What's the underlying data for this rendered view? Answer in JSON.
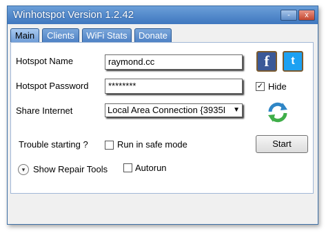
{
  "window": {
    "title": "Winhotspot Version 1.2.42",
    "minimize_label": "-",
    "close_label": "x"
  },
  "tabs": [
    {
      "label": "Main"
    },
    {
      "label": "Clients"
    },
    {
      "label": "WiFi Stats"
    },
    {
      "label": "Donate"
    }
  ],
  "main": {
    "hotspot_name_label": "Hotspot Name",
    "hotspot_name_value": "raymond.cc",
    "hotspot_password_label": "Hotspot Password",
    "hotspot_password_value": "********",
    "hide_label": "Hide",
    "hide_checked": "✓",
    "share_internet_label": "Share Internet",
    "share_internet_value": "Local Area Connection {3935I",
    "trouble_label": "Trouble starting ?",
    "safe_mode_label": "Run in safe mode",
    "start_label": "Start",
    "show_repair_label": "Show Repair Tools",
    "autorun_label": "Autorun",
    "facebook_glyph": "f",
    "twitter_glyph": "t"
  },
  "icons": {
    "facebook": "facebook-icon",
    "twitter": "twitter-icon",
    "refresh": "refresh-icon",
    "expand": "chevron-down-icon"
  },
  "colors": {
    "titlebar": "#3f77bf",
    "facebook": "#3b5998",
    "twitter": "#1da1f2",
    "refresh": "#2f86c6"
  }
}
